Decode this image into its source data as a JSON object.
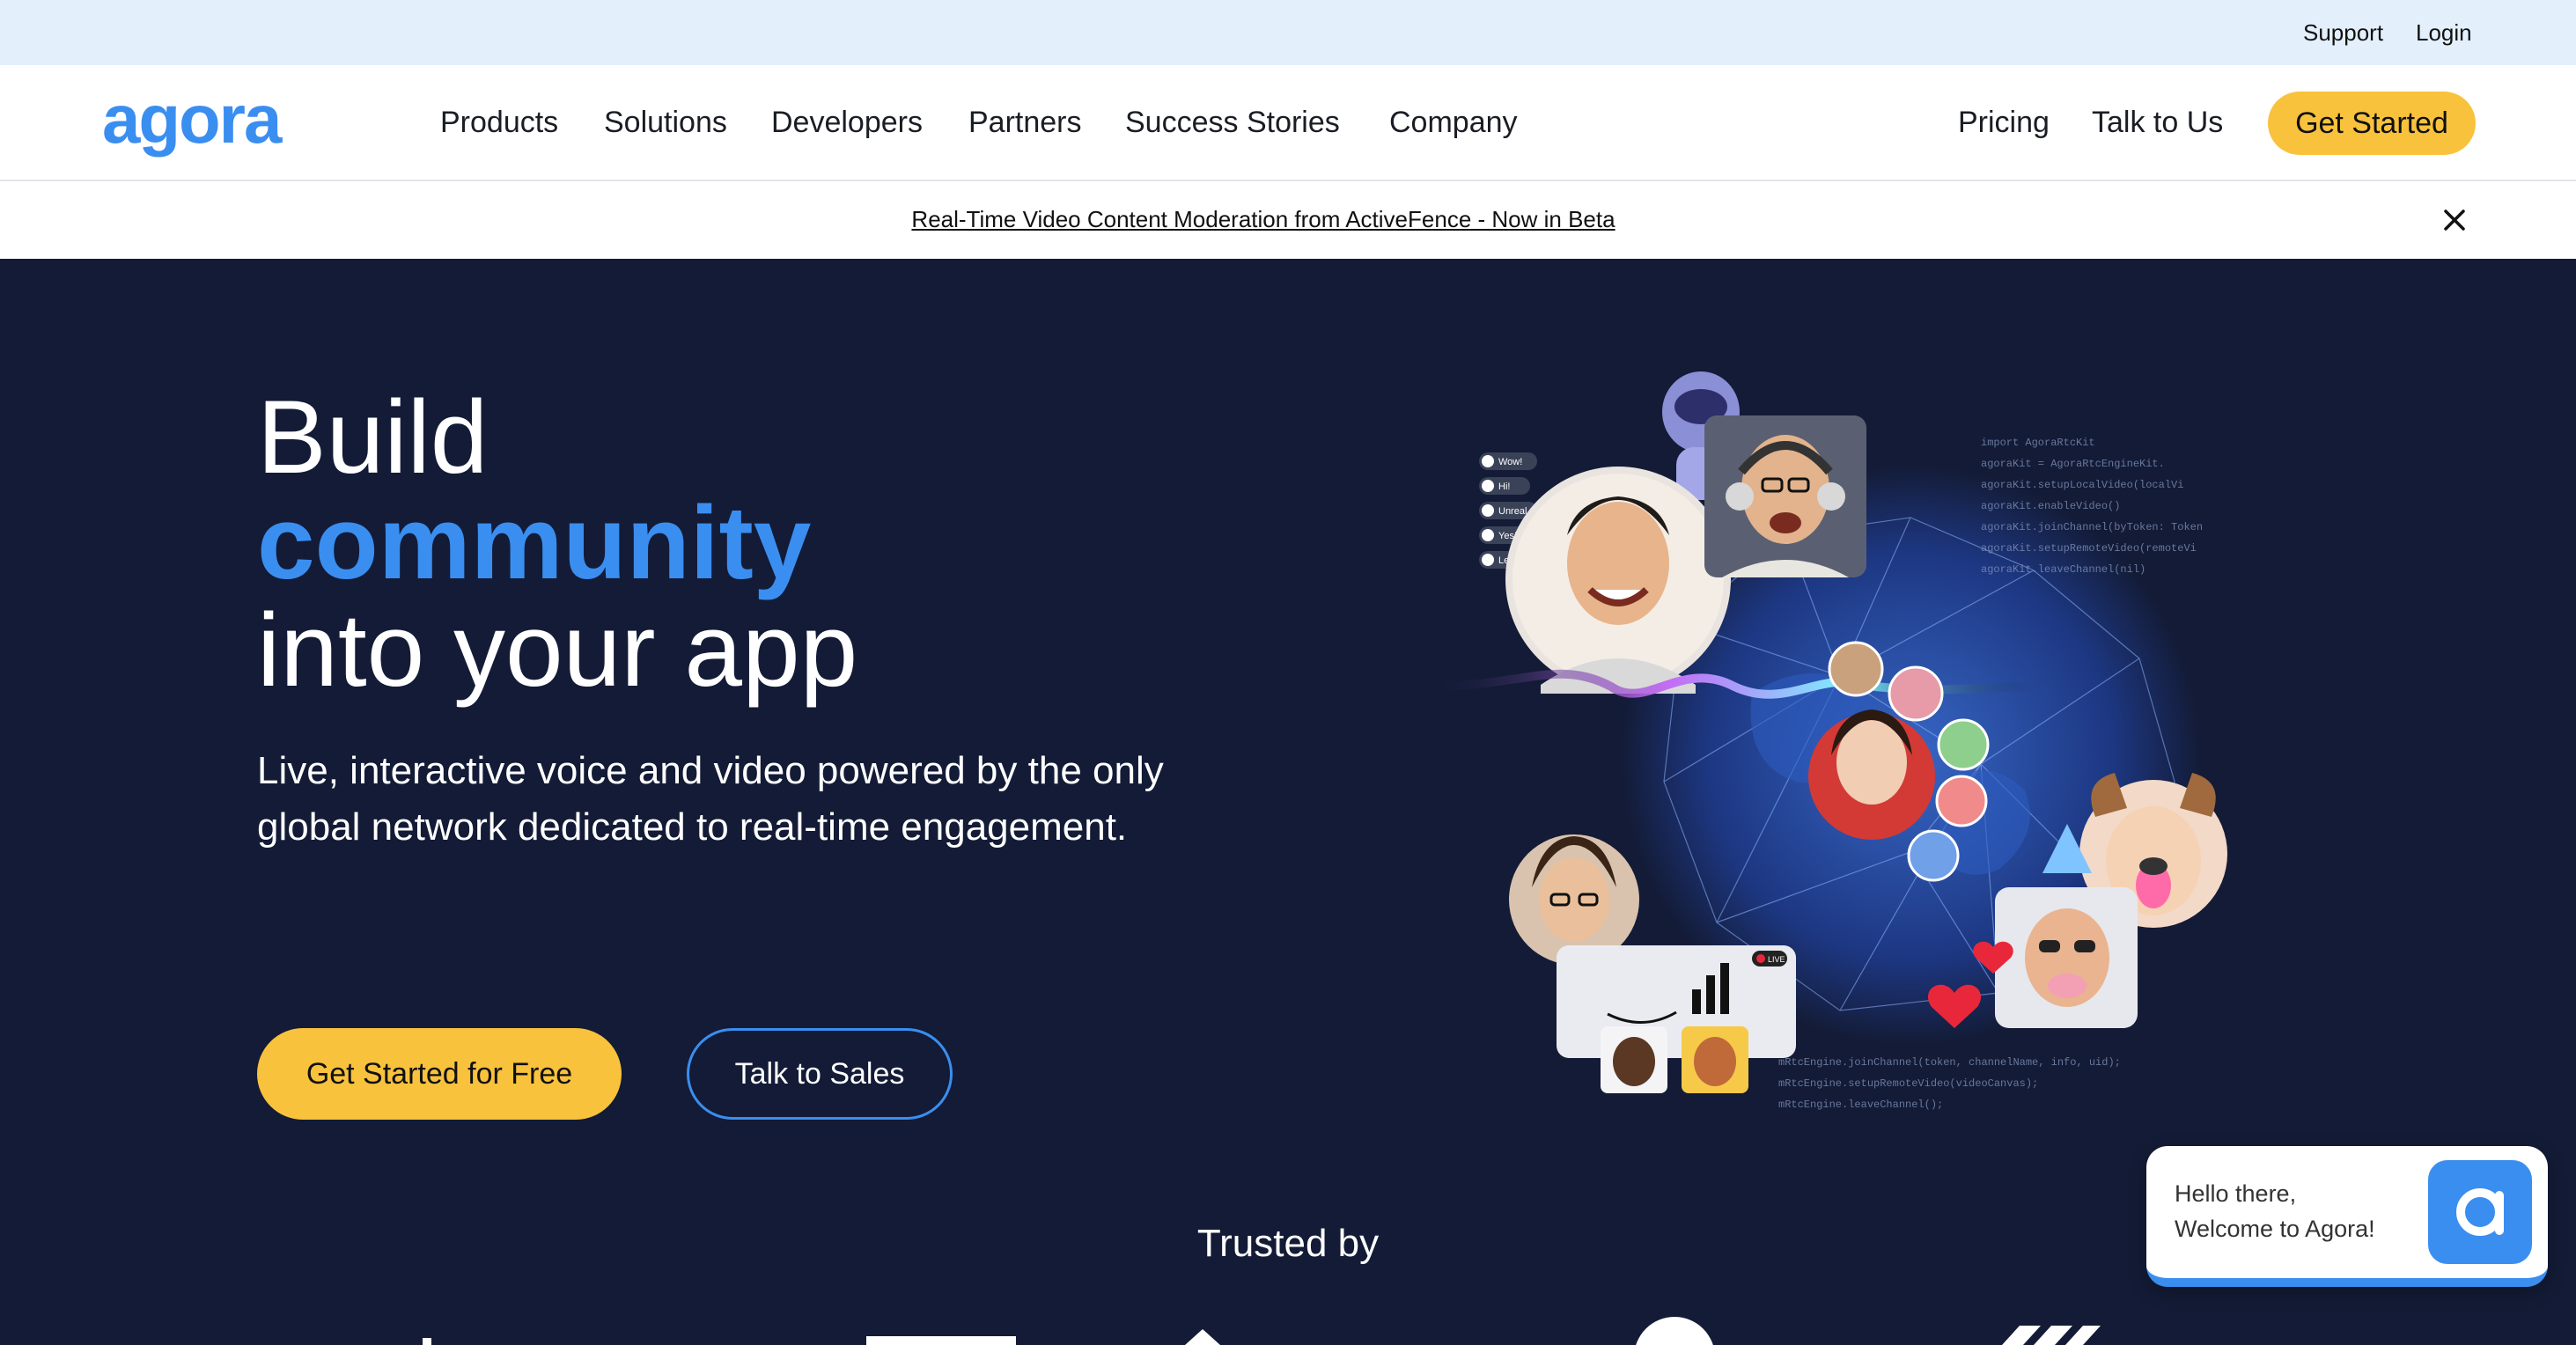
{
  "utility_bar": {
    "support": "Support",
    "login": "Login",
    "background": "#e3f0fc"
  },
  "nav": {
    "logo_text": "agora",
    "items": [
      {
        "label": "Products"
      },
      {
        "label": "Solutions"
      },
      {
        "label": "Developers"
      },
      {
        "label": "Partners"
      },
      {
        "label": "Success Stories"
      },
      {
        "label": "Company"
      }
    ],
    "pricing": "Pricing",
    "talk_to_us": "Talk to Us",
    "get_started": "Get Started"
  },
  "announcement": {
    "text": "Real-Time Video Content Moderation from ActiveFence - Now in Beta",
    "close_icon": "close-icon"
  },
  "hero": {
    "headline_line1": "Build",
    "headline_line2": "community",
    "headline_line3": "into your app",
    "subtitle": "Live, interactive voice and video powered by the only global network dedicated to real-time engagement.",
    "cta_primary": "Get Started for Free",
    "cta_secondary": "Talk to Sales",
    "illustration": {
      "chat_chips": [
        "Wow!",
        "Hi!",
        "Unreal",
        "Yes!",
        "Let's go!"
      ],
      "live_badge": "LIVE",
      "code_lines_top": [
        "import AgoraRtcKit",
        "agoraKit = AgoraRtcEngineKit.",
        "agoraKit.setupLocalVideo(localVi",
        "agoraKit.enableVideo()",
        "agoraKit.joinChannel(byToken: Token",
        "agoraKit.setupRemoteVideo(remoteVi",
        "agoraKit.leaveChannel(nil)"
      ],
      "code_lines_bottom": [
        "mRtcEngine.joinChannel(token, channelName, info, uid);",
        "mRtcEngine.setupRemoteVideo(videoCanvas);",
        "mRtcEngine.leaveChannel();"
      ]
    }
  },
  "trusted": {
    "label": "Trusted by"
  },
  "chat_widget": {
    "line1": "Hello there,",
    "line2": "Welcome to Agora!"
  },
  "colors": {
    "hero_bg": "#131b36",
    "accent_blue": "#3a8ef0",
    "accent_yellow": "#f9c23d"
  }
}
